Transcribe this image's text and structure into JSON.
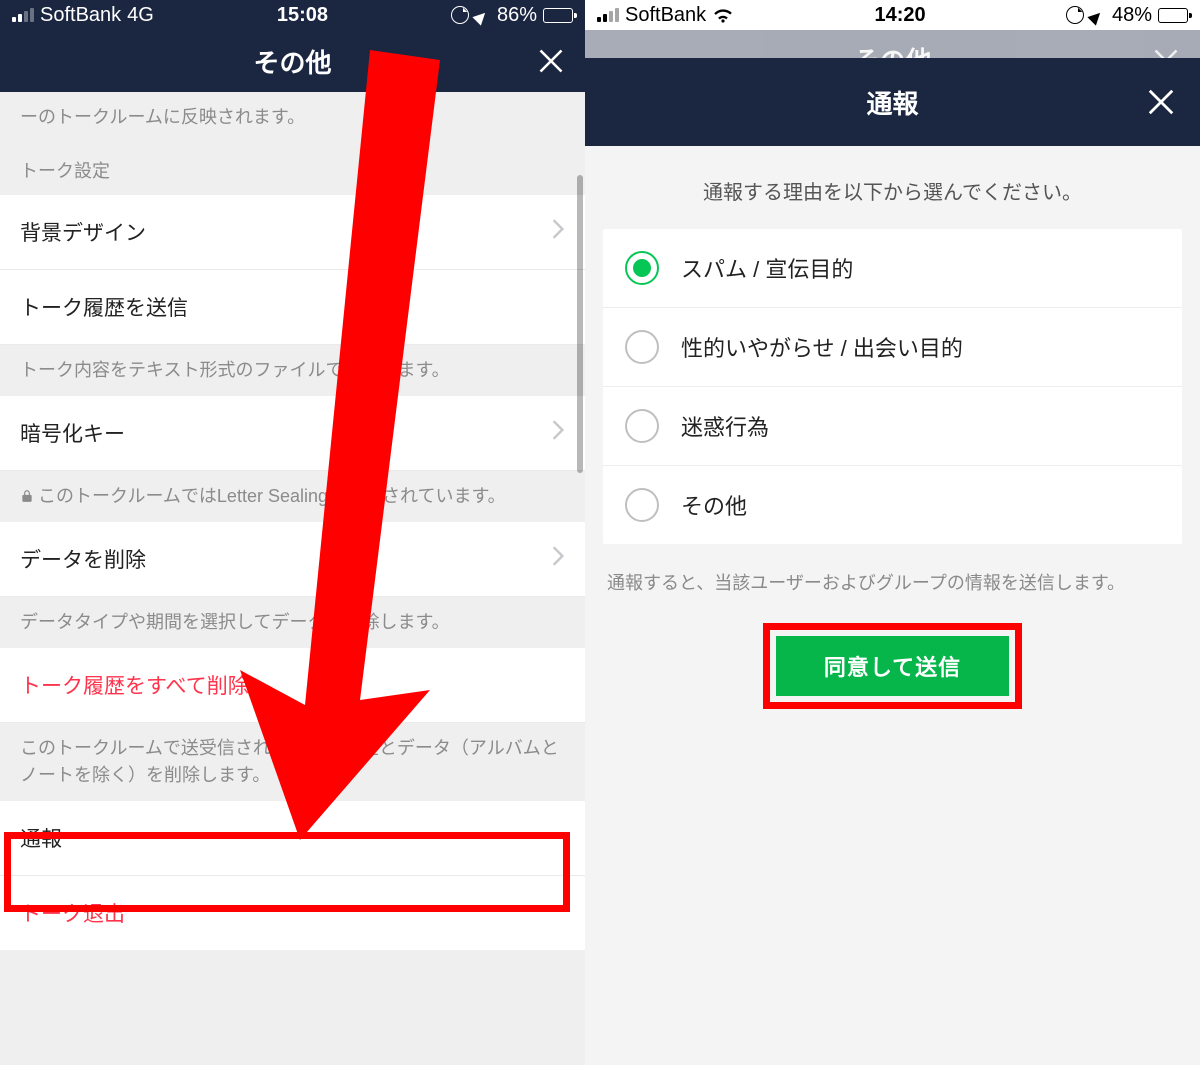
{
  "left": {
    "status": {
      "carrier": "SoftBank",
      "net": "4G",
      "time": "15:08",
      "battery_pct": "86%"
    },
    "nav_title": "その他",
    "note_top": "ーのトークルームに反映されます。",
    "section_talk": "トーク設定",
    "row_background": "背景デザイン",
    "row_send_history": "トーク履歴を送信",
    "note_send": "トーク内容をテキスト形式のファイルで送信します。",
    "row_encrypt": "暗号化キー",
    "note_encrypt": "このトークルームではLetter Sealingが適用されています。",
    "row_delete_data": "データを削除",
    "note_delete": "データタイプや期間を選択してデータを削除します。",
    "row_delete_all": "トーク履歴をすべて削除",
    "note_delete_all": "このトークルームで送受信されたトーク履歴とデータ（アルバムとノートを除く）を削除します。",
    "row_report": "通報",
    "row_leave": "トーク退出"
  },
  "right": {
    "status": {
      "carrier": "SoftBank",
      "time": "14:20",
      "battery_pct": "48%"
    },
    "dim_title": "その他",
    "sheet_title": "通報",
    "prompt": "通報する理由を以下から選んでください。",
    "options": [
      {
        "label": "スパム / 宣伝目的",
        "selected": true
      },
      {
        "label": "性的いやがらせ / 出会い目的",
        "selected": false
      },
      {
        "label": "迷惑行為",
        "selected": false
      },
      {
        "label": "その他",
        "selected": false
      }
    ],
    "disclaimer": "通報すると、当該ユーザーおよびグループの情報を送信します。",
    "submit": "同意して送信"
  }
}
